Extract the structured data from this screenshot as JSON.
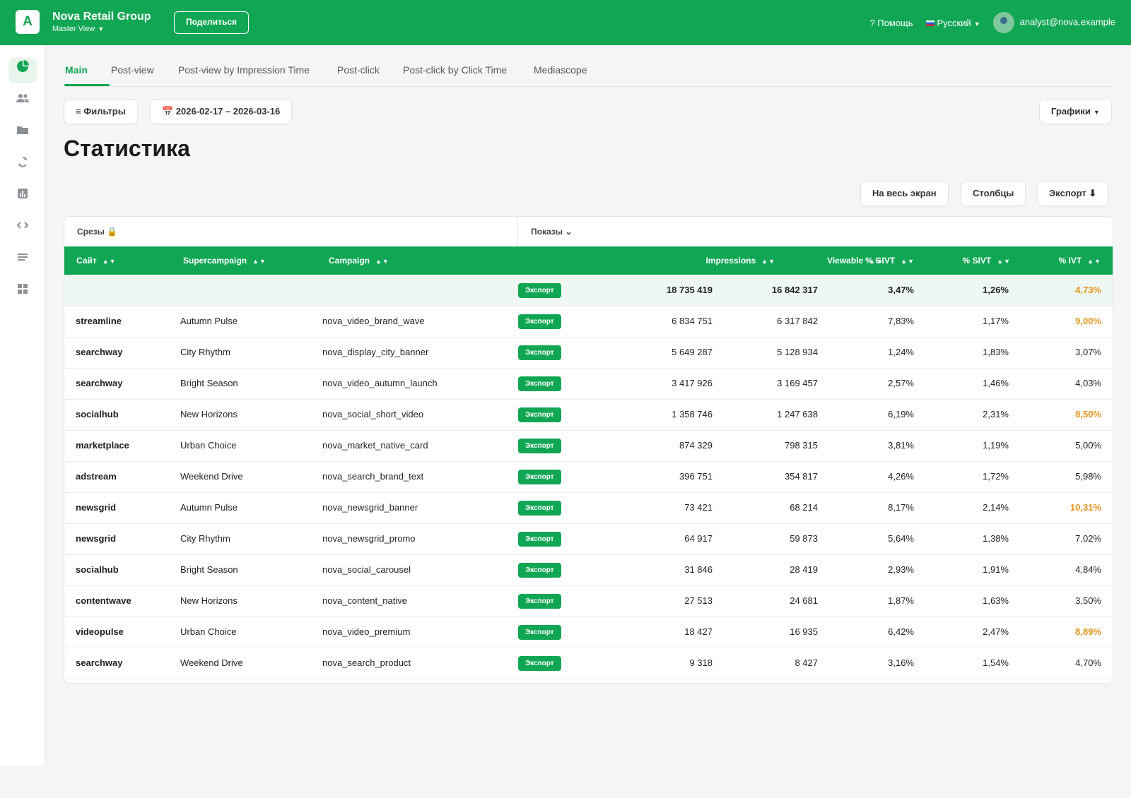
{
  "header": {
    "logo_letter": "A",
    "org_name": "Nova Retail Group",
    "view_name": "Master View",
    "share_label": "Поделиться",
    "help_label": "? Помощь",
    "language_label": "Русский",
    "user_email": "analyst@nova.example"
  },
  "sidebar": {
    "icons": [
      "pie-chart-icon",
      "users-icon",
      "folder-icon",
      "sync-icon",
      "bar-chart-icon",
      "code-icon",
      "list-icon",
      "grid-icon"
    ]
  },
  "tabs": [
    "Main",
    "Post-view",
    "Post-view by Impression Time",
    "Post-click",
    "Post-click by Click Time",
    "Mediascope"
  ],
  "toolbar": {
    "filters_label": "≡ Фильтры",
    "date_range": "📅 2026-02-17 – 2026-03-16",
    "charts_label": "Графики"
  },
  "page_title": "Статистика",
  "actions": {
    "fullscreen_label": "На весь экран",
    "columns_label": "Столбцы",
    "export_label": "Экспорт ⬇"
  },
  "table": {
    "slices_label": "Срезы 🔒",
    "shows_label": "Показы ⌄",
    "columns": [
      "Сайт",
      "Supercampaign",
      "Campaign",
      "Impressions",
      "Viewable",
      "% GIVT",
      "% SIVT",
      "% IVT"
    ],
    "export_badge": "Экспорт",
    "total": {
      "impressions": "18 735 419",
      "viewable": "16 842 317",
      "givt": "3,47%",
      "sivt": "1,26%",
      "ivt": "4,73%"
    },
    "rows": [
      {
        "site": "streamline",
        "supercampaign": "Autumn Pulse",
        "campaign": "nova_video_brand_wave",
        "impressions": "6 834 751",
        "viewable": "6 317 842",
        "givt": "7,83%",
        "sivt": "1,17%",
        "ivt": "9,00%"
      },
      {
        "site": "searchway",
        "supercampaign": "City Rhythm",
        "campaign": "nova_display_city_banner",
        "impressions": "5 649 287",
        "viewable": "5 128 934",
        "givt": "1,24%",
        "sivt": "1,83%",
        "ivt": "3,07%"
      },
      {
        "site": "searchway",
        "supercampaign": "Bright Season",
        "campaign": "nova_video_autumn_launch",
        "impressions": "3 417 926",
        "viewable": "3 169 457",
        "givt": "2,57%",
        "sivt": "1,46%",
        "ivt": "4,03%"
      },
      {
        "site": "socialhub",
        "supercampaign": "New Horizons",
        "campaign": "nova_social_short_video",
        "impressions": "1 358 746",
        "viewable": "1 247 638",
        "givt": "6,19%",
        "sivt": "2,31%",
        "ivt": "8,50%"
      },
      {
        "site": "marketplace",
        "supercampaign": "Urban Choice",
        "campaign": "nova_market_native_card",
        "impressions": "874 329",
        "viewable": "798 315",
        "givt": "3,81%",
        "sivt": "1,19%",
        "ivt": "5,00%"
      },
      {
        "site": "adstream",
        "supercampaign": "Weekend Drive",
        "campaign": "nova_search_brand_text",
        "impressions": "396 751",
        "viewable": "354 817",
        "givt": "4,26%",
        "sivt": "1,72%",
        "ivt": "5,98%"
      },
      {
        "site": "newsgrid",
        "supercampaign": "Autumn Pulse",
        "campaign": "nova_newsgrid_banner",
        "impressions": "73 421",
        "viewable": "68 214",
        "givt": "8,17%",
        "sivt": "2,14%",
        "ivt": "10,31%"
      },
      {
        "site": "newsgrid",
        "supercampaign": "City Rhythm",
        "campaign": "nova_newsgrid_promo",
        "impressions": "64 917",
        "viewable": "59 873",
        "givt": "5,64%",
        "sivt": "1,38%",
        "ivt": "7,02%"
      },
      {
        "site": "socialhub",
        "supercampaign": "Bright Season",
        "campaign": "nova_social_carousel",
        "impressions": "31 846",
        "viewable": "28 419",
        "givt": "2,93%",
        "sivt": "1,91%",
        "ivt": "4,84%"
      },
      {
        "site": "contentwave",
        "supercampaign": "New Horizons",
        "campaign": "nova_content_native",
        "impressions": "27 513",
        "viewable": "24 681",
        "givt": "1,87%",
        "sivt": "1,63%",
        "ivt": "3,50%"
      },
      {
        "site": "videopulse",
        "supercampaign": "Urban Choice",
        "campaign": "nova_video_premium",
        "impressions": "18 427",
        "viewable": "16 935",
        "givt": "6,42%",
        "sivt": "2,47%",
        "ivt": "8,89%"
      },
      {
        "site": "searchway",
        "supercampaign": "Weekend Drive",
        "campaign": "nova_search_product",
        "impressions": "9 318",
        "viewable": "8 427",
        "givt": "3,16%",
        "sivt": "1,54%",
        "ivt": "4,70%"
      }
    ]
  },
  "colors": {
    "brand": "#11a654",
    "warning": "#e3941b"
  }
}
